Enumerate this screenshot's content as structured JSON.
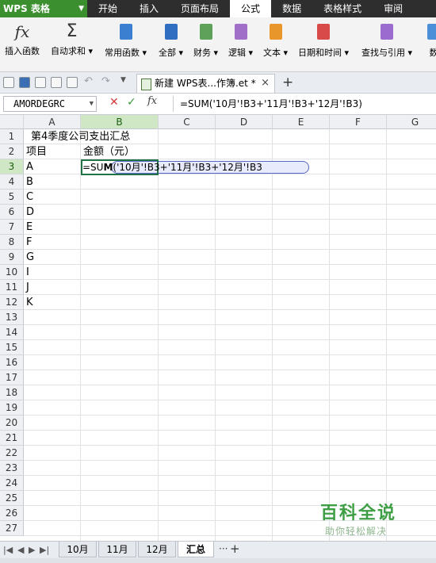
{
  "menubar": {
    "app_label": "WPS 表格",
    "tabs": [
      "开始",
      "插入",
      "页面布局",
      "公式",
      "数据",
      "表格样式",
      "审阅"
    ],
    "active_tab": "公式"
  },
  "ribbon": {
    "buttons": [
      {
        "label": "插入函数"
      },
      {
        "label": "自动求和"
      },
      {
        "label": "常用函数"
      },
      {
        "label": "全部"
      },
      {
        "label": "财务"
      },
      {
        "label": "逻辑"
      },
      {
        "label": "文本"
      },
      {
        "label": "日期和时间"
      },
      {
        "label": "查找与引用"
      },
      {
        "label": "数"
      }
    ],
    "colors": {
      "all": "#3a7fd0",
      "finance": "#5fa05a",
      "logic": "#a070c8",
      "text": "#e8952a",
      "date": "#d84a4a",
      "lookup": "#9b6bd0"
    }
  },
  "tabbar": {
    "document_tab": "新建 WPS表...作簿.et *",
    "close_label": "×",
    "new_tab_label": "+"
  },
  "formula_bar": {
    "name_box": "AMORDEGRC",
    "fx_label": "fx",
    "formula": "=SUM('10月'!B3+'11月'!B3+'12月'!B3)"
  },
  "grid": {
    "columns": [
      "A",
      "B",
      "C",
      "D",
      "E",
      "F",
      "G"
    ],
    "selected_column": "B",
    "rows": [
      "1",
      "2",
      "3",
      "4",
      "5",
      "6",
      "7",
      "8",
      "9",
      "10",
      "11",
      "12",
      "13",
      "14",
      "15",
      "16",
      "17",
      "18",
      "19",
      "20",
      "21",
      "22",
      "23",
      "24",
      "25",
      "26",
      "27"
    ],
    "selected_row": "3",
    "cells": {
      "A1": "第4季度公司支出汇总",
      "A2": "项目",
      "B2": "金额（元）",
      "A3": "A",
      "A4": "B",
      "A5": "C",
      "A6": "D",
      "A7": "E",
      "A8": "F",
      "A9": "G",
      "A10": "I",
      "A11": "J",
      "A12": "K"
    },
    "edit_cell": {
      "address": "B3",
      "prefix": "=SU",
      "cursor_char": "M",
      "rest": "('10月'!B3+'11月'!B3+'12月'!B3"
    }
  },
  "sheets": {
    "tabs": [
      "10月",
      "11月",
      "12月",
      "汇总"
    ],
    "active": "汇总",
    "more_label": "···",
    "add_label": "+"
  },
  "watermark": {
    "title": "百科全说",
    "subtitle": "助你轻松解决"
  }
}
